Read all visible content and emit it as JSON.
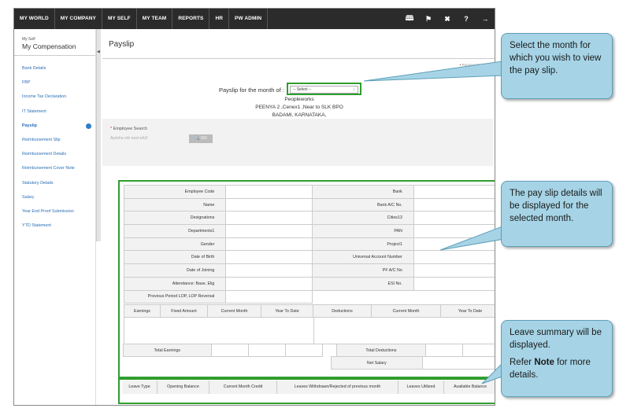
{
  "topnav": {
    "items": [
      "MY WORLD",
      "MY COMPANY",
      "MY SELF",
      "MY TEAM",
      "REPORTS",
      "HR",
      "PW ADMIN"
    ],
    "icons": [
      "book-icon",
      "flag-icon",
      "tools-icon",
      "help-icon",
      "logout-icon"
    ]
  },
  "sidebar": {
    "crumb": "My Self",
    "title": "My Compensation",
    "items": [
      {
        "label": "Bank Details"
      },
      {
        "label": "FBP"
      },
      {
        "label": "Income Tax Declaration"
      },
      {
        "label": "IT Statement"
      },
      {
        "label": "Payslip",
        "active": true
      },
      {
        "label": "Reimbursement Slip"
      },
      {
        "label": "Reimbursement Details"
      },
      {
        "label": "Reimbursement Cover Note"
      },
      {
        "label": "Statutory Details"
      },
      {
        "label": "Salary"
      },
      {
        "label": "Year End Proof Submission"
      },
      {
        "label": "YTD Statement"
      }
    ]
  },
  "page": {
    "title": "Payslip",
    "required_note": "Required Fields",
    "month_label": "Payslip for the month of :",
    "month_select": "-- Select --",
    "company": "Peopleworks",
    "address1": "PEENYA 2 ,Cenex1 ,Near to SLK BPO",
    "address2": "BADAMI, KARNATAKA,"
  },
  "search": {
    "label": "Employee Search",
    "value": "Ayesha orb next-orb2",
    "go": "GO"
  },
  "details": {
    "left": [
      "Employee Code",
      "Name",
      "Designations",
      "Departments1",
      "Gender",
      "Date of Birth",
      "Date of Joining",
      "Attendance: Base, Elig",
      "Previous Period LOP, LOP Reversal"
    ],
    "right": [
      "Bank",
      "Bank A/C No.",
      "Cities13",
      "PAN",
      "Project1",
      "Universal Account Number",
      "PF A/C No",
      "ESI No."
    ]
  },
  "earnings": {
    "headers_left": [
      "Earnings",
      "Fixed Amount",
      "Current Month",
      "Year To Date"
    ],
    "headers_right": [
      "Deductions",
      "Current Month",
      "Year To Date"
    ],
    "total_earnings": "Total Earnings",
    "total_deductions": "Total Deductions",
    "net_salary": "Net Salary"
  },
  "leave": {
    "headers": [
      "Leave Type",
      "Opening Balance",
      "Current Month Credit",
      "Leaves Withdrawn/Rejected of previous month",
      "Leaves Utilized",
      "Available Balance"
    ]
  },
  "callouts": {
    "month": "Select the month for which you wish to view the pay slip.",
    "details": "The pay slip details will be displayed for the selected month.",
    "leave_line1": "Leave summary will be displayed.",
    "leave_refer": "Refer",
    "leave_note": "Note",
    "leave_tail": "for more details."
  },
  "colors": {
    "nav_bg": "#2b2b2b",
    "link": "#2a6fb5",
    "highlight": "#2e9e2e",
    "callout": "#a6d4e6"
  }
}
